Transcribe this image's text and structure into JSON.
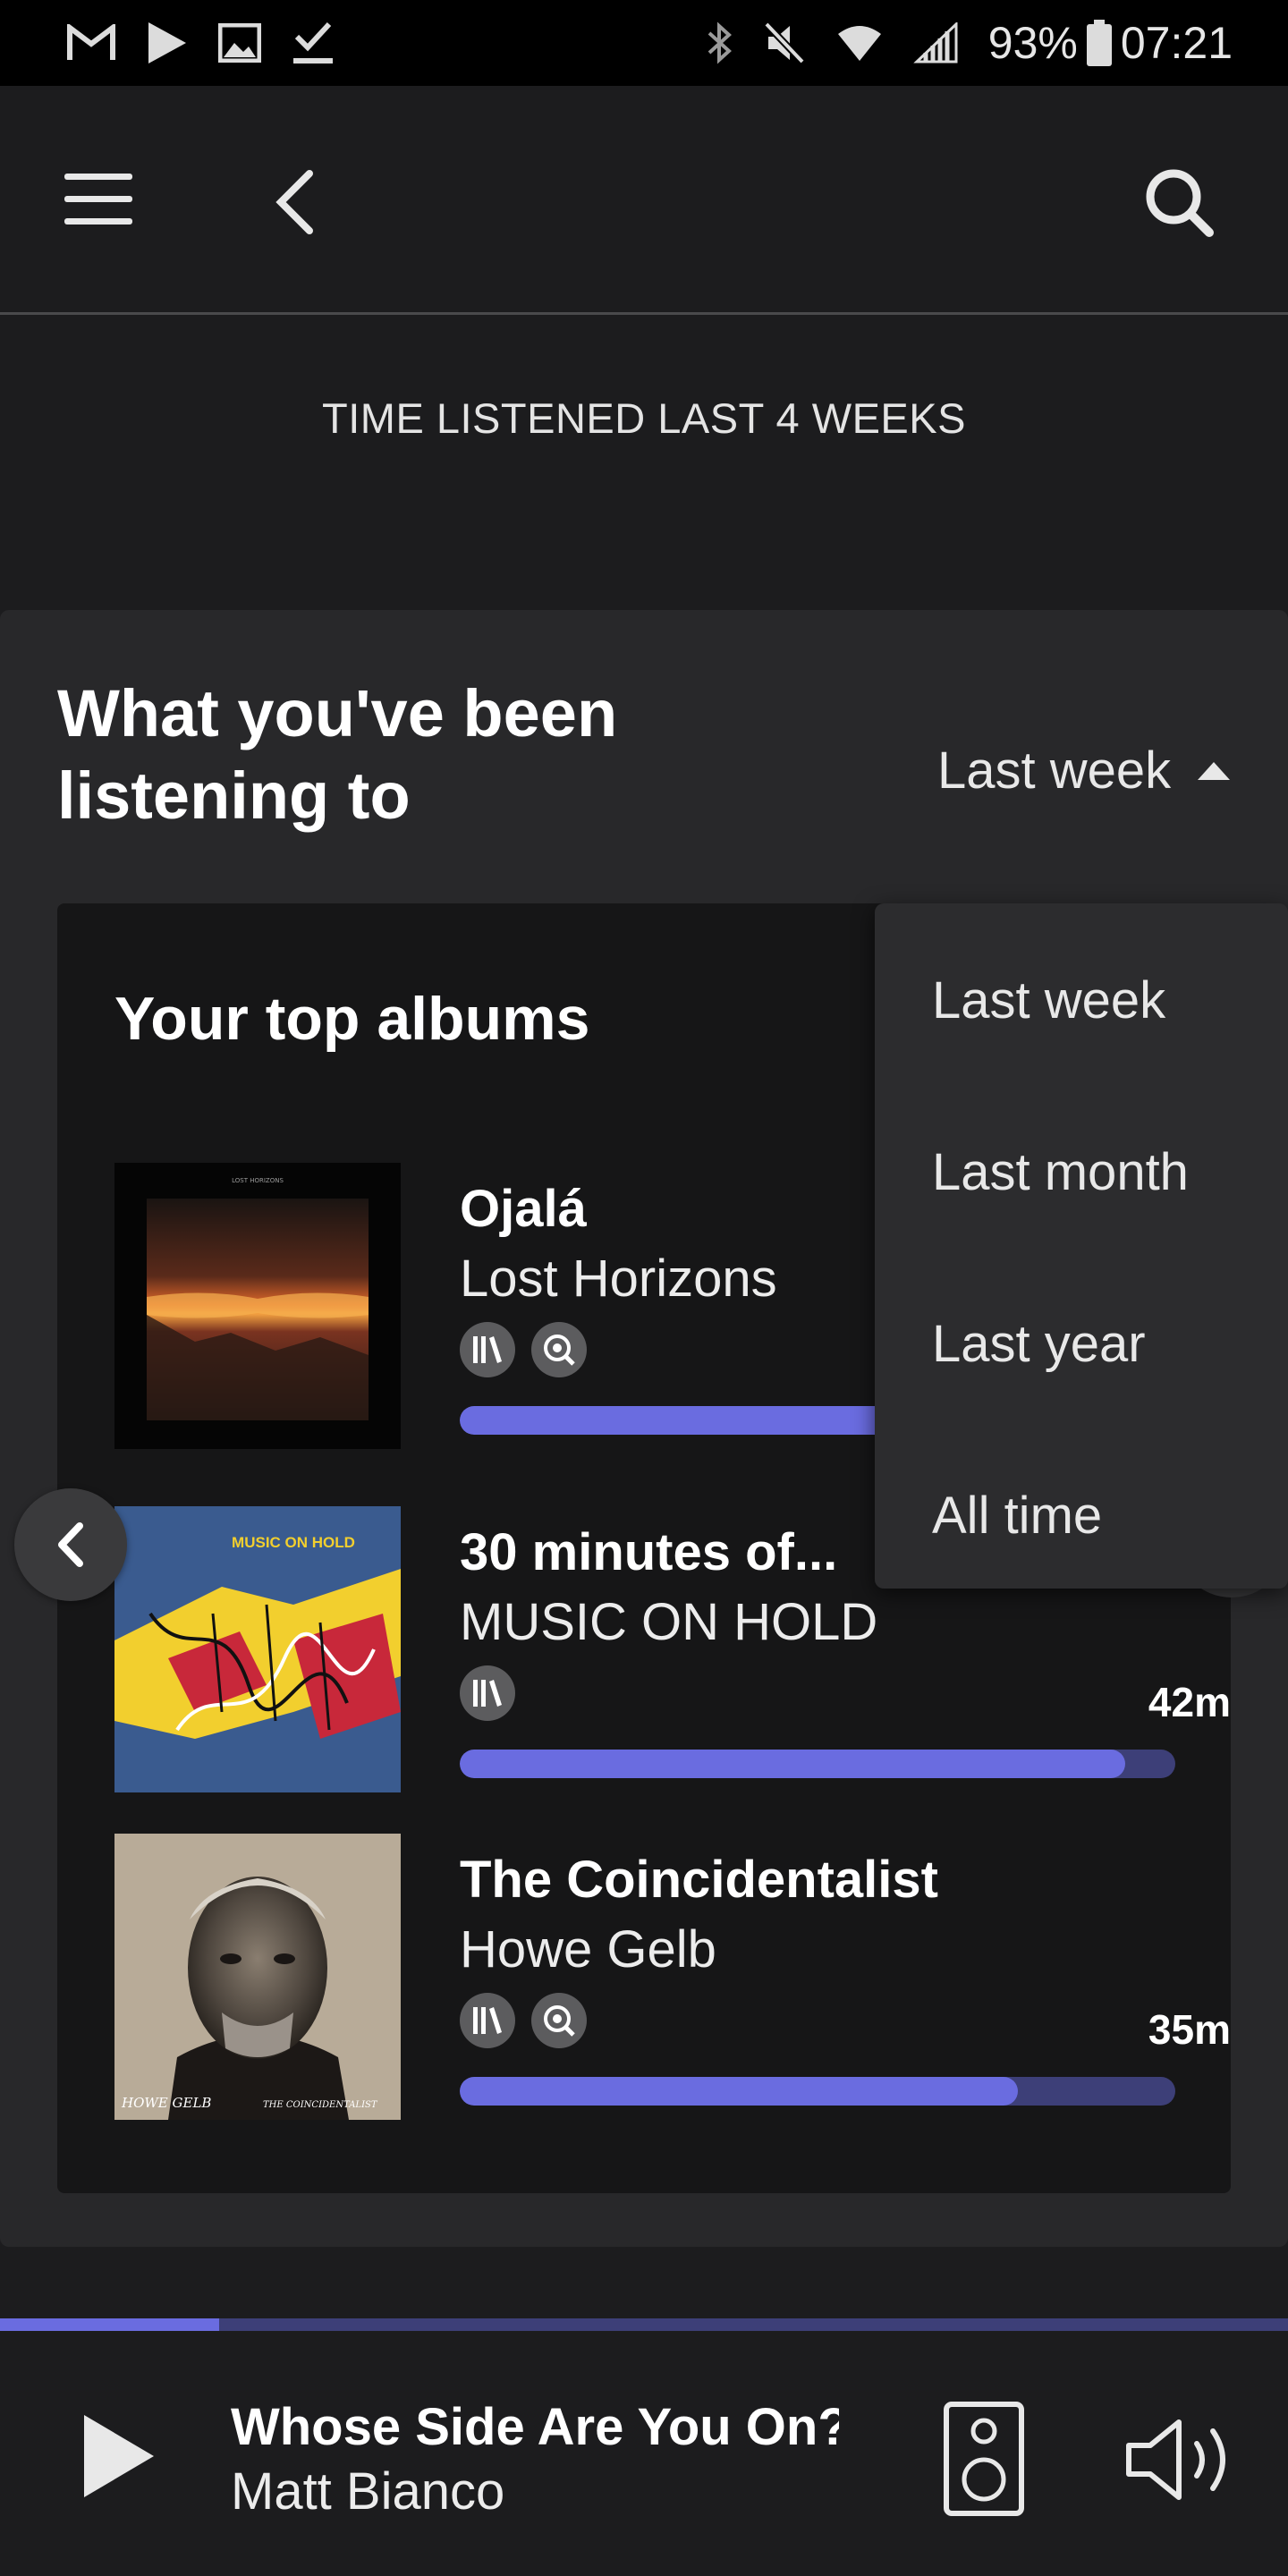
{
  "status_bar": {
    "battery": "93%",
    "time": "07:21"
  },
  "header": {
    "time_listened": "TIME LISTENED LAST 4 WEEKS"
  },
  "section": {
    "title": "What you've been listening to",
    "period_selected": "Last week"
  },
  "top_albums": {
    "title": "Your top albums",
    "items": [
      {
        "title": "Ojalá",
        "artist": "Lost Horizons",
        "duration": "",
        "progress": 0.95
      },
      {
        "title": "30 minutes of...",
        "artist": "MUSIC ON HOLD",
        "duration": "42m",
        "progress": 0.93
      },
      {
        "title": "The Coincidentalist",
        "artist": "Howe Gelb",
        "duration": "35m",
        "progress": 0.78
      }
    ],
    "cover_texts": {
      "album1": "LOST HORIZONS",
      "album2": "MUSIC ON HOLD",
      "album3_left": "HOWE GELB",
      "album3_right": "THE COINCIDENTALIST"
    }
  },
  "dropdown": {
    "options": [
      "Last week",
      "Last month",
      "Last year",
      "All time"
    ]
  },
  "player": {
    "track": "Whose Side Are You On?",
    "artist": "Matt Bianco",
    "progress": 0.17
  },
  "colors": {
    "accent": "#6a6ce0",
    "accent_track": "#3d3f78",
    "background": "#1c1c1e"
  }
}
